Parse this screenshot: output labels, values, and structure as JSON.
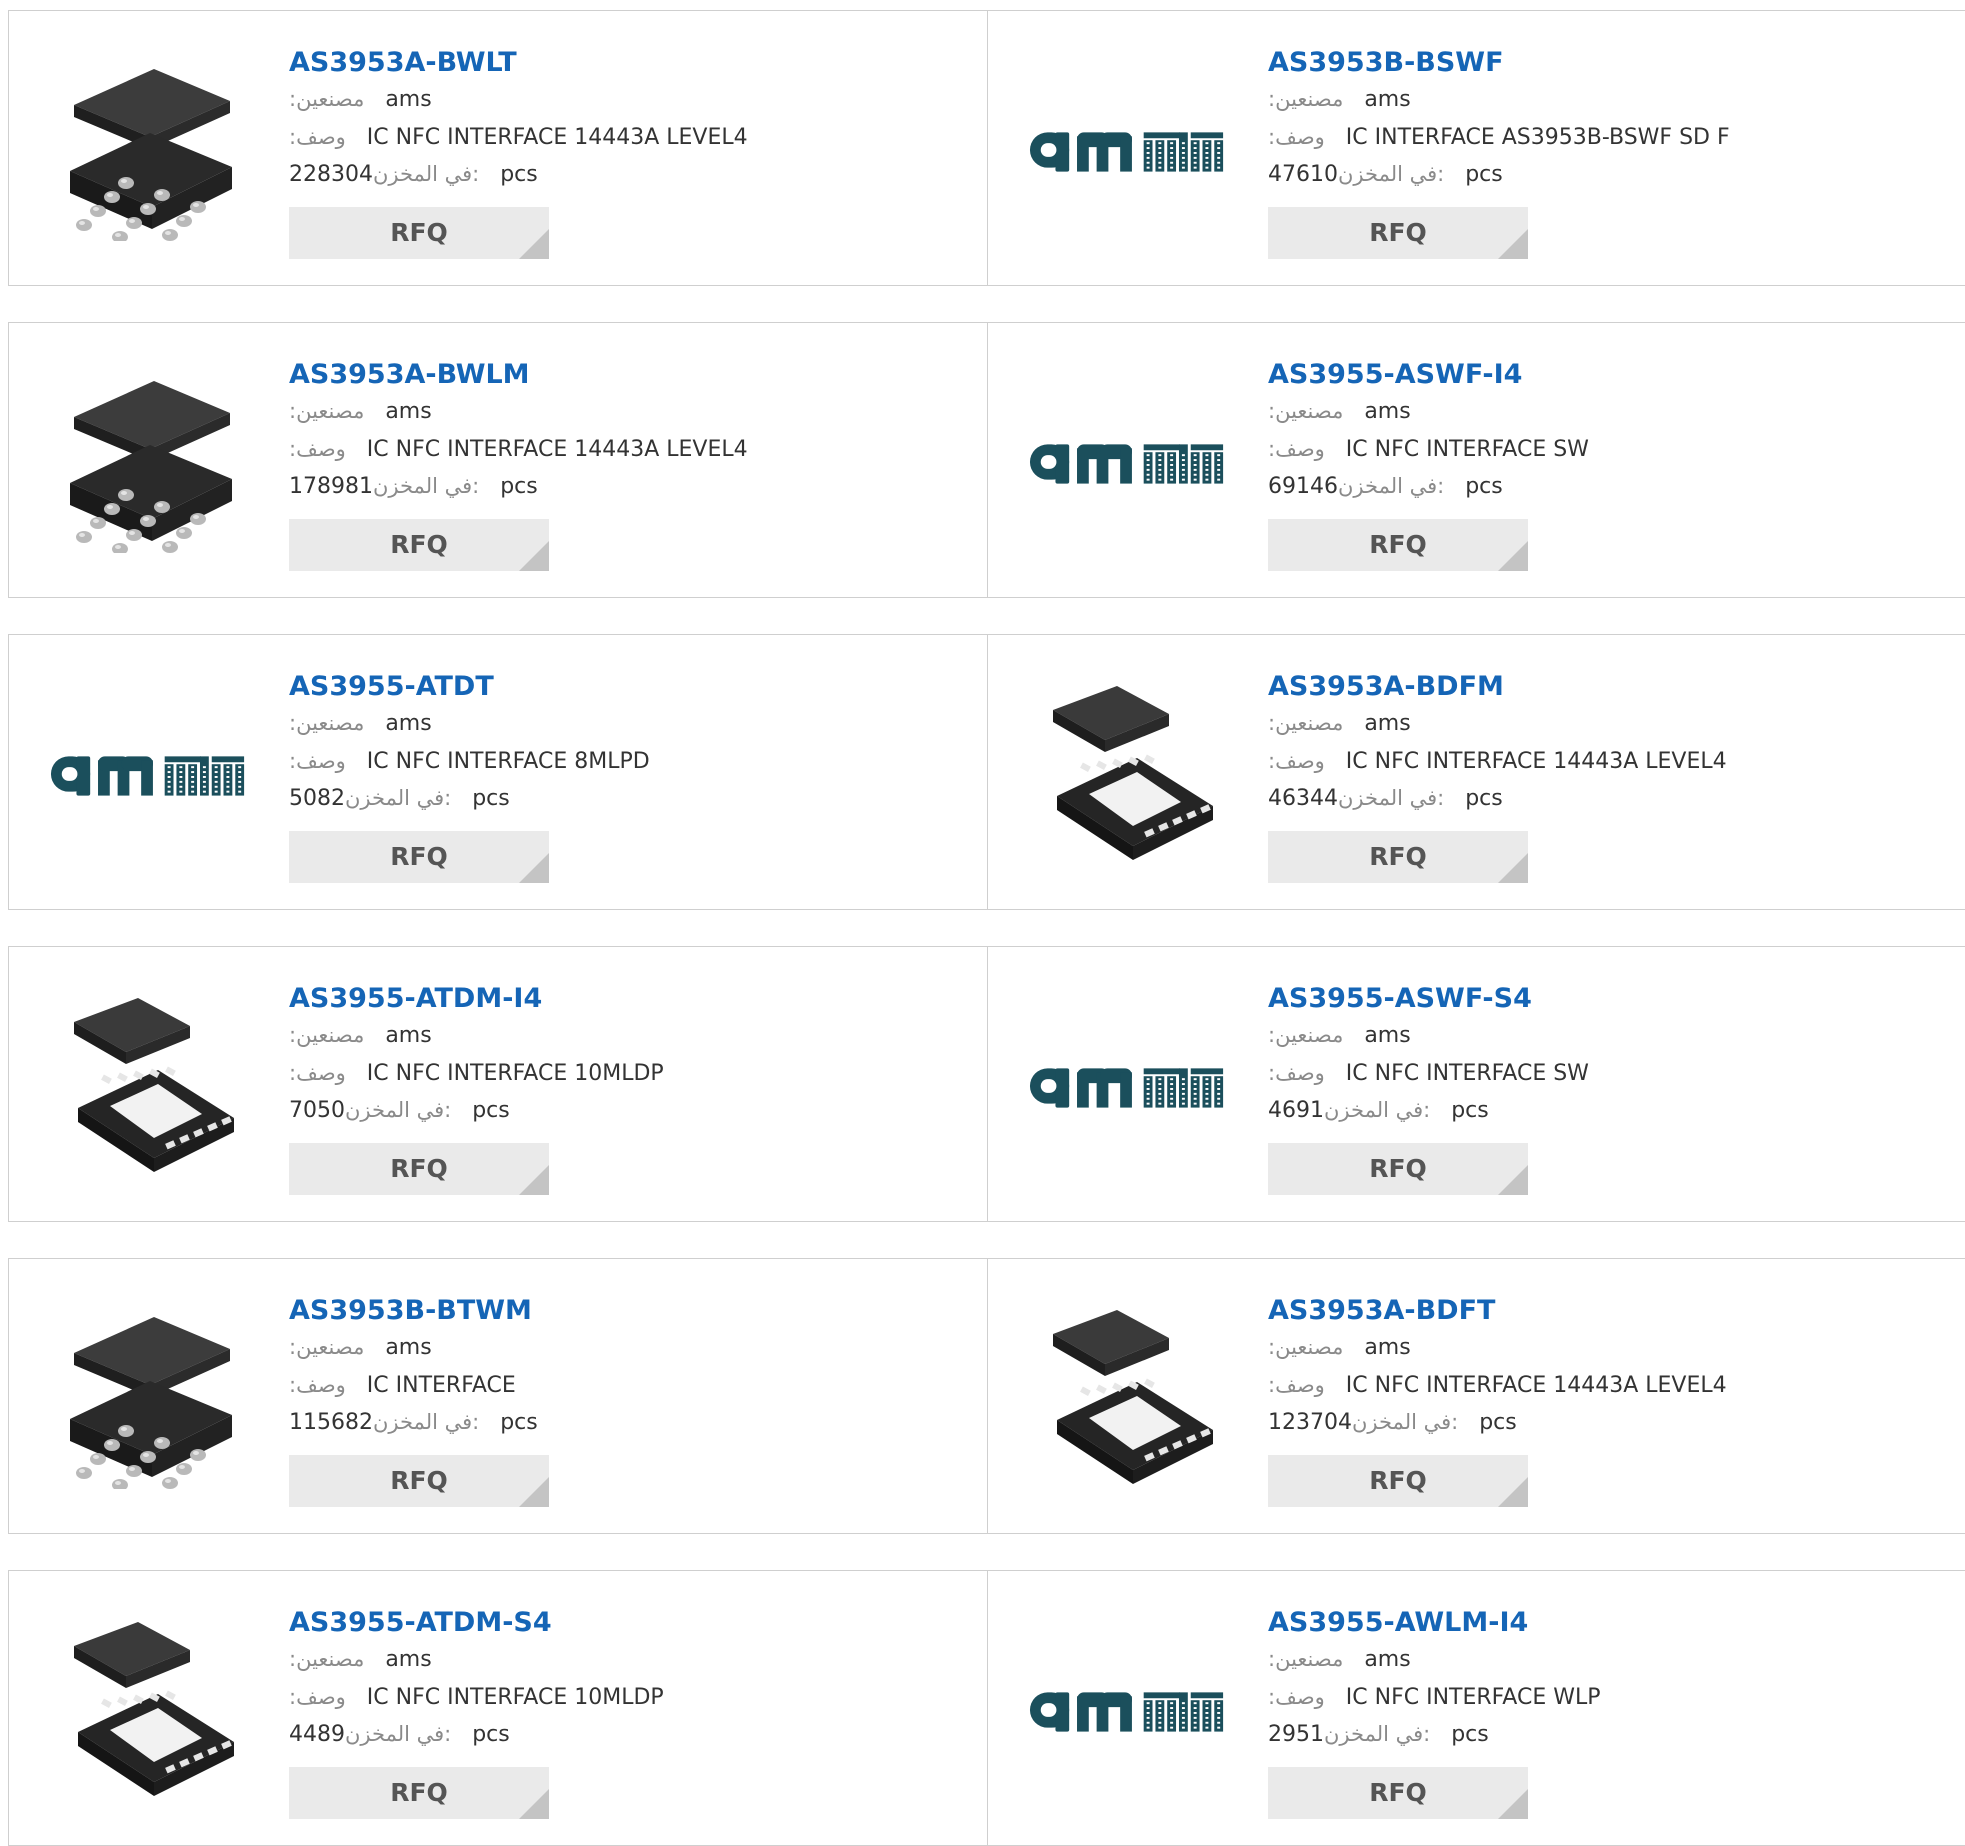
{
  "labels": {
    "manufacturer": ":مصنعين",
    "description": ":وصف",
    "stock": "في المخزن:",
    "pcs": "pcs",
    "rfq": "RFQ"
  },
  "colors": {
    "part_link": "#1565b6",
    "ams_logo": "#1b4f5c",
    "card_border": "#cfcfcf",
    "rfq_bg": "#eaeaea"
  },
  "products": [
    {
      "part": "AS3953A-BWLT",
      "manufacturer": "ams",
      "description": "IC NFC INTERFACE 14443A LEVEL4",
      "stock": "228304",
      "image": "wlcsp-chip-icon"
    },
    {
      "part": "AS3953B-BSWF",
      "manufacturer": "ams",
      "description": "IC INTERFACE AS3953B-BSWF SD F",
      "stock": "47610",
      "image": "ams-logo"
    },
    {
      "part": "AS3953A-BWLM",
      "manufacturer": "ams",
      "description": "IC NFC INTERFACE 14443A LEVEL4",
      "stock": "178981",
      "image": "wlcsp-chip-icon"
    },
    {
      "part": "AS3955-ASWF-I4",
      "manufacturer": "ams",
      "description": "IC NFC INTERFACE SW",
      "stock": "69146",
      "image": "ams-logo"
    },
    {
      "part": "AS3955-ATDT",
      "manufacturer": "ams",
      "description": "IC NFC INTERFACE 8MLPD",
      "stock": "5082",
      "image": "ams-logo"
    },
    {
      "part": "AS3953A-BDFM",
      "manufacturer": "ams",
      "description": "IC NFC INTERFACE 14443A LEVEL4",
      "stock": "46344",
      "image": "dfn-chip-icon"
    },
    {
      "part": "AS3955-ATDM-I4",
      "manufacturer": "ams",
      "description": "IC NFC INTERFACE 10MLDP",
      "stock": "7050",
      "image": "dfn-chip-icon"
    },
    {
      "part": "AS3955-ASWF-S4",
      "manufacturer": "ams",
      "description": "IC NFC INTERFACE SW",
      "stock": "4691",
      "image": "ams-logo"
    },
    {
      "part": "AS3953B-BTWM",
      "manufacturer": "ams",
      "description": "IC INTERFACE",
      "stock": "115682",
      "image": "wlcsp-chip-icon"
    },
    {
      "part": "AS3953A-BDFT",
      "manufacturer": "ams",
      "description": "IC NFC INTERFACE 14443A LEVEL4",
      "stock": "123704",
      "image": "dfn-chip-icon"
    },
    {
      "part": "AS3955-ATDM-S4",
      "manufacturer": "ams",
      "description": "IC NFC INTERFACE 10MLDP",
      "stock": "4489",
      "image": "dfn-chip-icon"
    },
    {
      "part": "AS3955-AWLM-I4",
      "manufacturer": "ams",
      "description": "IC NFC INTERFACE WLP",
      "stock": "2951",
      "image": "ams-logo"
    }
  ]
}
